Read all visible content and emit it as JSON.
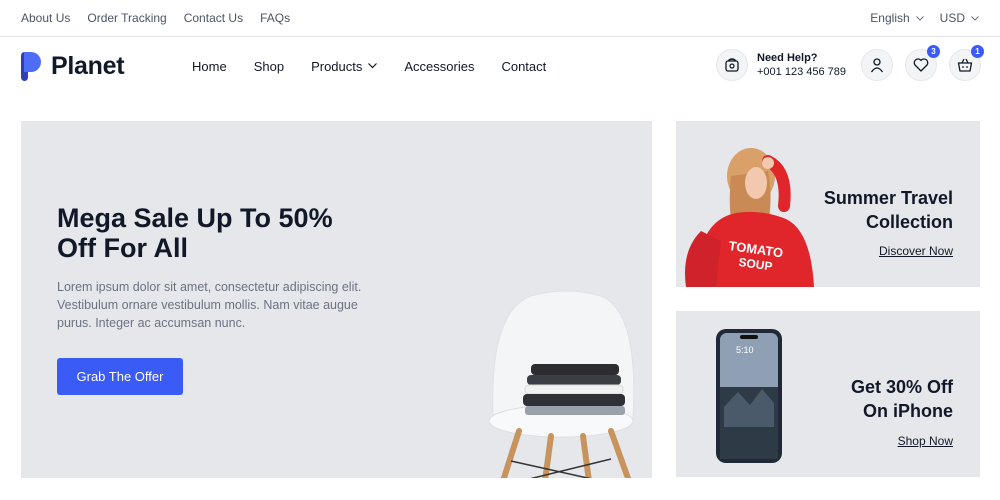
{
  "topbar": {
    "links": [
      "About Us",
      "Order Tracking",
      "Contact Us",
      "FAQs"
    ],
    "language": "English",
    "currency": "USD"
  },
  "header": {
    "logo_text": "Planet",
    "nav": [
      "Home",
      "Shop",
      "Products",
      "Accessories",
      "Contact"
    ],
    "help_title": "Need Help?",
    "help_phone": "+001 123 456 789",
    "wishlist_count": "3",
    "cart_count": "1"
  },
  "hero": {
    "title": "Mega Sale Up To 50% Off For All",
    "description": "Lorem ipsum dolor sit amet, consectetur adipiscing elit. Vestibulum ornare vestibulum mollis. Nam vitae augue purus. Integer ac accumsan nunc.",
    "button": "Grab The Offer"
  },
  "promos": [
    {
      "title_line1": "Summer Travel",
      "title_line2": "Collection",
      "link": "Discover Now"
    },
    {
      "title_line1": "Get 30% Off",
      "title_line2": "On iPhone",
      "link": "Shop Now"
    }
  ],
  "colors": {
    "accent": "#3b5bf6",
    "panel": "#e5e7eb",
    "text": "#111827",
    "muted": "#6b7280"
  }
}
